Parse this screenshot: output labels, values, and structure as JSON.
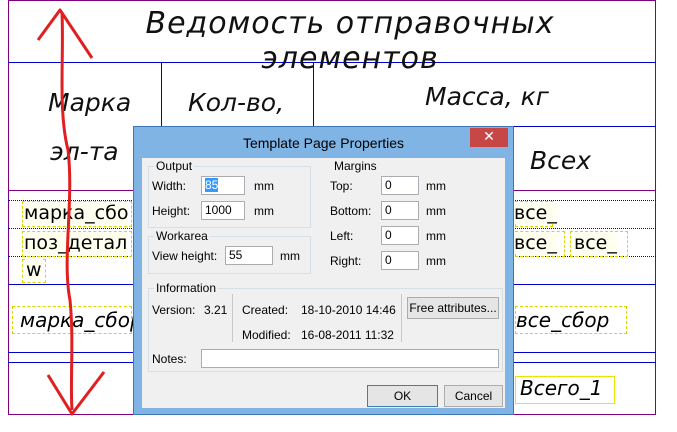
{
  "drawing": {
    "title": "Ведомость отправочных элементов",
    "col_mark": "Марка",
    "col_mark_cont": "эл-та",
    "col_qty": "Кол-во,",
    "col_mass": "Масса, кг",
    "col_all": "Всех",
    "field_mark_sbo": "марка_сбо",
    "field_poz": "поз_детал",
    "field_w": "w",
    "field_vse1": "все_",
    "field_vse2": "все_",
    "field_vse3": "все_",
    "field_mark_sbor": "марка_сбор",
    "field_vse_sbor": "все_сбор",
    "field_total": "Всего_1",
    "colors": {
      "frame": "#800080",
      "row_rule": "#0000cc",
      "annotation": "#e02020"
    }
  },
  "dialog": {
    "title": "Template Page Properties",
    "close_glyph": "✕",
    "output": {
      "label": "Output",
      "width_label": "Width:",
      "width_value": "85",
      "width_unit": "mm",
      "height_label": "Height:",
      "height_value": "1000",
      "height_unit": "mm"
    },
    "workarea": {
      "label": "Workarea",
      "view_height_label": "View height:",
      "view_height_value": "55",
      "view_height_unit": "mm"
    },
    "margins": {
      "label": "Margins",
      "top_label": "Top:",
      "top_value": "0",
      "bottom_label": "Bottom:",
      "bottom_value": "0",
      "left_label": "Left:",
      "left_value": "0",
      "right_label": "Right:",
      "right_value": "0",
      "unit": "mm"
    },
    "information": {
      "label": "Information",
      "version_label": "Version:",
      "version_value": "3.21",
      "created_label": "Created:",
      "created_value": "18-10-2010 14:46",
      "modified_label": "Modified:",
      "modified_value": "16-08-2011 11:32",
      "free_attributes_label": "Free attributes...",
      "notes_label": "Notes:",
      "notes_value": ""
    },
    "ok_label": "OK",
    "cancel_label": "Cancel"
  }
}
